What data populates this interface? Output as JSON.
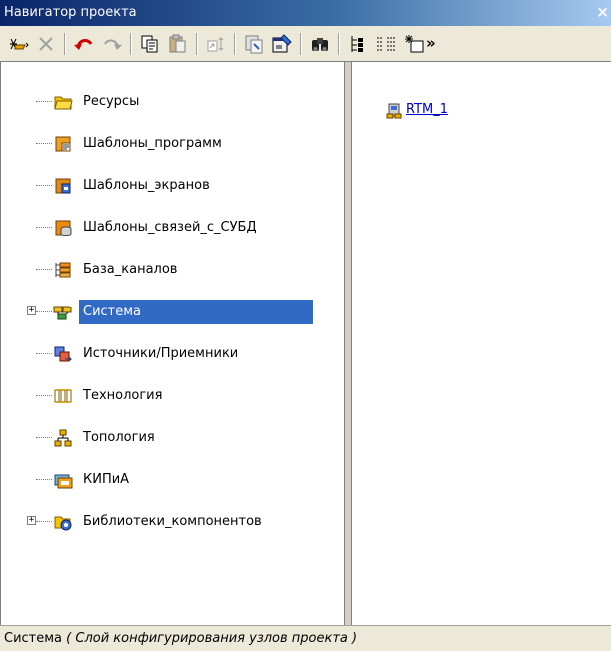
{
  "window": {
    "title": "Навигатор проекта",
    "close_glyph": "×"
  },
  "toolbar": {
    "buttons": [
      {
        "name": "new-object-icon"
      },
      {
        "name": "delete-icon"
      },
      {
        "name": "undo-icon"
      },
      {
        "name": "redo-icon"
      },
      {
        "name": "copy-icon"
      },
      {
        "name": "paste-icon"
      },
      {
        "name": "sort-icon"
      },
      {
        "name": "export-icon"
      },
      {
        "name": "properties-icon"
      },
      {
        "name": "find-icon"
      },
      {
        "name": "tree-view-icon"
      },
      {
        "name": "list-view-icon"
      },
      {
        "name": "new-item-icon"
      }
    ],
    "overflow_glyph": "»"
  },
  "tree": {
    "items": [
      {
        "label": "Ресурсы",
        "icon": "folder-icon",
        "expandable": false,
        "selected": false
      },
      {
        "label": "Шаблоны_программ",
        "icon": "program-template-icon",
        "expandable": false,
        "selected": false
      },
      {
        "label": "Шаблоны_экранов",
        "icon": "screen-template-icon",
        "expandable": false,
        "selected": false
      },
      {
        "label": "Шаблоны_связей_с_СУБД",
        "icon": "sql-template-icon",
        "expandable": false,
        "selected": false
      },
      {
        "label": "База_каналов",
        "icon": "channel-base-icon",
        "expandable": false,
        "selected": false
      },
      {
        "label": "Система",
        "icon": "system-icon",
        "expandable": true,
        "selected": true
      },
      {
        "label": "Источники/Приемники",
        "icon": "sources-icon",
        "expandable": false,
        "selected": false
      },
      {
        "label": "Технология",
        "icon": "technology-icon",
        "expandable": false,
        "selected": false
      },
      {
        "label": "Топология",
        "icon": "topology-icon",
        "expandable": false,
        "selected": false
      },
      {
        "label": "КИПиА",
        "icon": "kipia-icon",
        "expandable": false,
        "selected": false
      },
      {
        "label": "Библиотеки_компонентов",
        "icon": "component-library-icon",
        "expandable": true,
        "selected": false
      }
    ],
    "expand_glyph": "+"
  },
  "list": {
    "items": [
      {
        "label": "RTM_1",
        "icon": "rtm-node-icon"
      }
    ]
  },
  "status": {
    "main": "Система",
    "detail": "( Слой конфигурирования узлов проекта )"
  },
  "colors": {
    "selection": "#316ac5",
    "link": "#0000cc"
  }
}
